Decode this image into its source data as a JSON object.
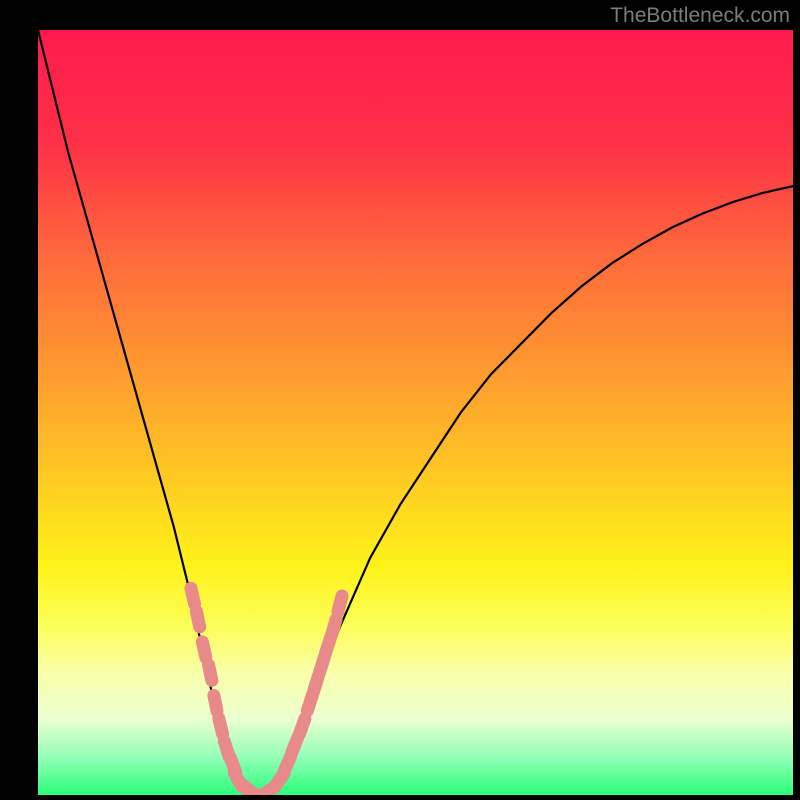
{
  "watermark": "TheBottleneck.com",
  "chart_data": {
    "type": "line",
    "title": "",
    "xlabel": "",
    "ylabel": "",
    "xlim": [
      0,
      100
    ],
    "ylim": [
      0,
      100
    ],
    "background": {
      "type": "vertical-gradient",
      "stops": [
        {
          "offset": 0,
          "color": "#ff1a4e"
        },
        {
          "offset": 15,
          "color": "#ff3147"
        },
        {
          "offset": 30,
          "color": "#ff6b3b"
        },
        {
          "offset": 45,
          "color": "#ff9b2f"
        },
        {
          "offset": 58,
          "color": "#ffc823"
        },
        {
          "offset": 70,
          "color": "#fff218"
        },
        {
          "offset": 78,
          "color": "#fdff5a"
        },
        {
          "offset": 84,
          "color": "#f8ffa8"
        },
        {
          "offset": 90,
          "color": "#ecffd0"
        },
        {
          "offset": 95,
          "color": "#95ffb8"
        },
        {
          "offset": 100,
          "color": "#2bff7a"
        }
      ]
    },
    "series": [
      {
        "name": "bottleneck-curve",
        "type": "line",
        "color": "#000000",
        "x": [
          0,
          2,
          4,
          6,
          8,
          10,
          12,
          14,
          16,
          18,
          20,
          22,
          24,
          25,
          26,
          27,
          28,
          29,
          30,
          31,
          32,
          33,
          34,
          36,
          38,
          40,
          44,
          48,
          52,
          56,
          60,
          64,
          68,
          72,
          76,
          80,
          84,
          88,
          92,
          96,
          100
        ],
        "values": [
          100,
          92,
          84,
          77,
          70,
          63,
          56,
          49,
          42,
          35,
          27,
          18,
          9,
          5,
          2,
          0.5,
          0,
          0,
          0,
          0.5,
          2,
          4,
          7,
          12,
          17,
          22,
          31,
          38,
          44,
          50,
          55,
          59,
          63,
          66.5,
          69.5,
          72,
          74.2,
          76,
          77.5,
          78.7,
          79.6
        ]
      },
      {
        "name": "dotted-markers",
        "type": "scatter",
        "color": "#e88a8a",
        "x": [
          20.5,
          21.2,
          22,
          22.8,
          23.5,
          24.2,
          25,
          25.8,
          26.5,
          27.5,
          29,
          30.5,
          32,
          33,
          34,
          35,
          36,
          36.8,
          37.6,
          38.4,
          39.2,
          40
        ],
        "values": [
          26,
          23,
          19,
          16,
          12,
          9,
          6,
          4,
          2,
          1,
          0,
          0.5,
          2,
          4,
          6.5,
          9,
          12,
          14.5,
          17,
          19.5,
          22,
          25
        ]
      }
    ]
  }
}
